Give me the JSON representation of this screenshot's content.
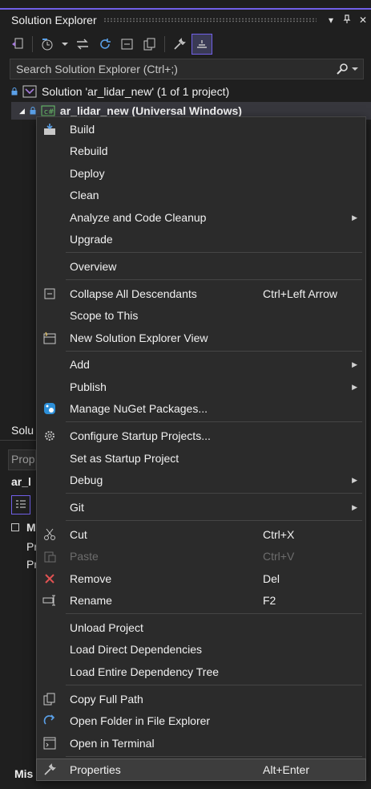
{
  "explorer": {
    "title": "Solution Explorer",
    "title_buttons": [
      "▾",
      "⊥",
      "✕"
    ],
    "search_placeholder": "Search Solution Explorer (Ctrl+;)",
    "solution_label": "Solution 'ar_lidar_new' (1 of 1 project)",
    "project_label": "ar_lidar_new (Universal Windows)"
  },
  "background_panels": {
    "solution_tab": "Solu",
    "properties_tab": "Prop",
    "properties_object": "ar_l",
    "misc_header": "M",
    "prop_row_1": "Pr",
    "prop_row_2": "Pr",
    "misc_bottom": "Mis"
  },
  "context_menu": {
    "items": [
      {
        "label": "Build",
        "icon": "build-icon"
      },
      {
        "label": "Rebuild"
      },
      {
        "label": "Deploy"
      },
      {
        "label": "Clean"
      },
      {
        "label": "Analyze and Code Cleanup",
        "submenu": true
      },
      {
        "label": "Upgrade"
      },
      {
        "label": "Overview"
      },
      {
        "label": "Collapse All Descendants",
        "shortcut": "Ctrl+Left Arrow",
        "icon": "collapse-icon"
      },
      {
        "label": "Scope to This"
      },
      {
        "label": "New Solution Explorer View",
        "icon": "new-view-icon"
      },
      {
        "label": "Add",
        "submenu": true
      },
      {
        "label": "Publish",
        "submenu": true
      },
      {
        "label": "Manage NuGet Packages...",
        "icon": "nuget-icon"
      },
      {
        "label": "Configure Startup Projects...",
        "icon": "gear-icon"
      },
      {
        "label": "Set as Startup Project"
      },
      {
        "label": "Debug",
        "submenu": true
      },
      {
        "label": "Git",
        "submenu": true
      },
      {
        "label": "Cut",
        "shortcut": "Ctrl+X",
        "icon": "scissors-icon"
      },
      {
        "label": "Paste",
        "shortcut": "Ctrl+V",
        "icon": "paste-icon",
        "disabled": true
      },
      {
        "label": "Remove",
        "shortcut": "Del",
        "icon": "remove-x-icon"
      },
      {
        "label": "Rename",
        "shortcut": "F2",
        "icon": "rename-icon"
      },
      {
        "label": "Unload Project"
      },
      {
        "label": "Load Direct Dependencies"
      },
      {
        "label": "Load Entire Dependency Tree"
      },
      {
        "label": "Copy Full Path",
        "icon": "copy-icon"
      },
      {
        "label": "Open Folder in File Explorer",
        "icon": "open-folder-icon"
      },
      {
        "label": "Open in Terminal",
        "icon": "terminal-icon"
      },
      {
        "label": "Properties",
        "shortcut": "Alt+Enter",
        "icon": "wrench-icon",
        "highlighted": true
      }
    ]
  },
  "colors": {
    "accent": "#7160e8",
    "menu_bg": "#2b2b2b",
    "remove_icon": "#e05252",
    "nuget_icon": "#2d8fd8"
  }
}
